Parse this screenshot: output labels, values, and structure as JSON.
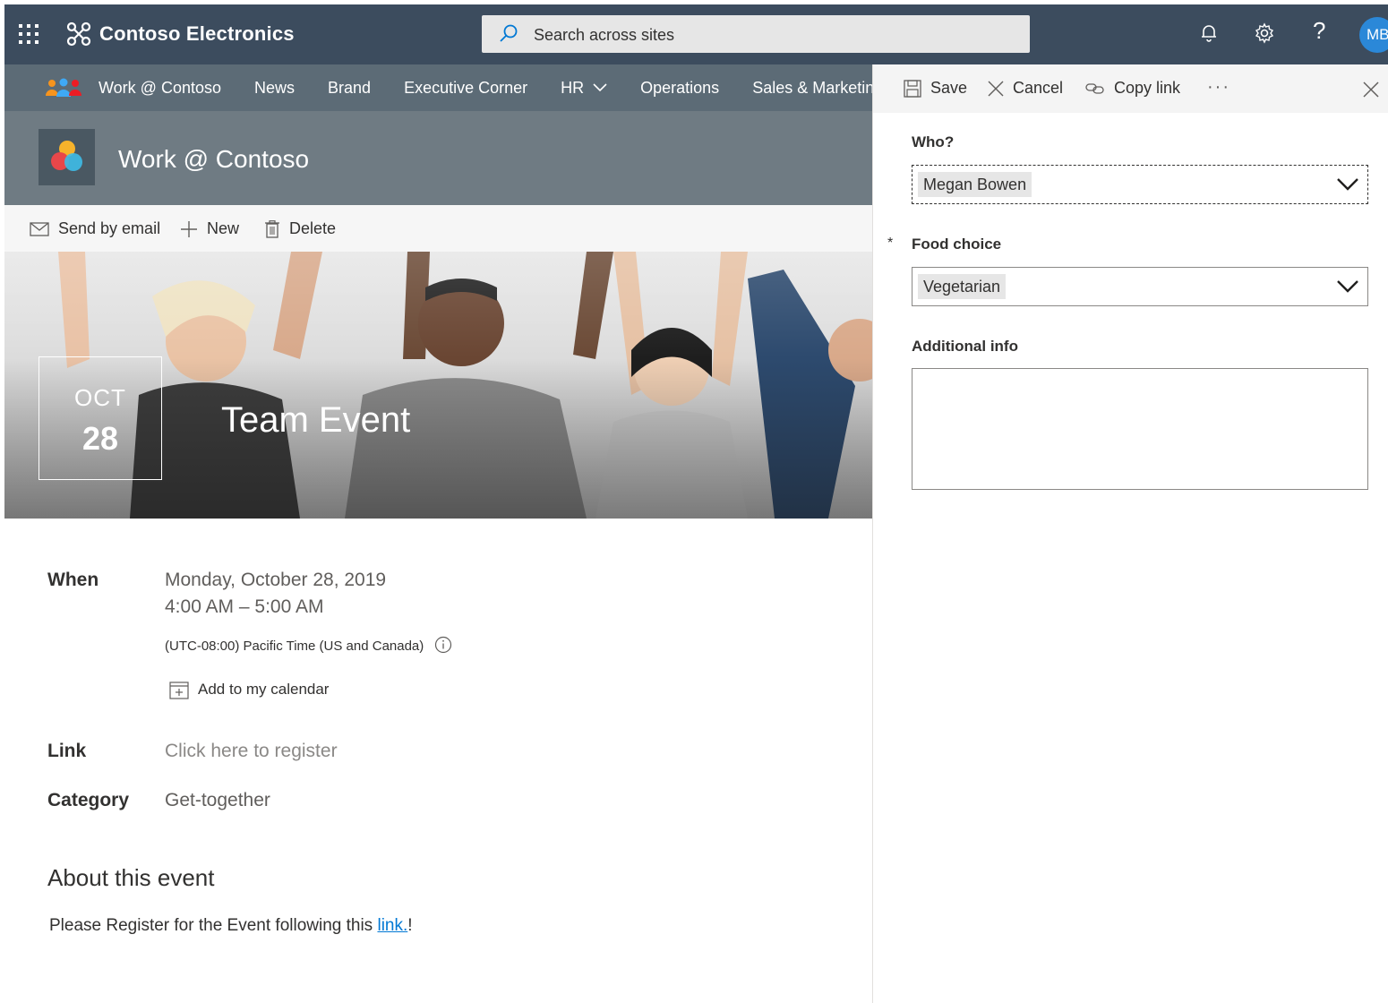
{
  "suitebar": {
    "brand": "Contoso Electronics",
    "search_placeholder": "Search across sites",
    "help": "?",
    "avatar_initials": "MB"
  },
  "sitenav": {
    "items": [
      "Work @ Contoso",
      "News",
      "Brand",
      "Executive Corner",
      "HR",
      "Operations",
      "Sales & Marketing"
    ]
  },
  "site": {
    "title": "Work @ Contoso"
  },
  "commands": {
    "send_by_email": "Send by email",
    "new": "New",
    "delete": "Delete"
  },
  "event": {
    "month": "OCT",
    "day": "28",
    "title": "Team Event",
    "when_label": "When",
    "date": "Monday, October 28, 2019",
    "time": "4:00 AM – 5:00 AM",
    "timezone": "(UTC-08:00) Pacific Time (US and Canada)",
    "add_to_calendar": "Add to my calendar",
    "link_label": "Link",
    "link_value": "Click here to register",
    "category_label": "Category",
    "category_value": "Get-together",
    "about_title": "About this event",
    "about_text_before": "Please Register for the Event following this ",
    "about_link": "link.",
    "about_text_after": "!"
  },
  "panel": {
    "save": "Save",
    "cancel": "Cancel",
    "copy_link": "Copy link",
    "more": "···",
    "fields": {
      "who_label": "Who?",
      "who_value": "Megan Bowen",
      "food_required_marker": "*",
      "food_label": "Food choice",
      "food_value": "Vegetarian",
      "info_label": "Additional info",
      "info_value": ""
    }
  },
  "colors": {
    "suitebar": "#3c4c5e",
    "sitenav": "#5c6b76",
    "siteheader": "#6f7b83",
    "accent": "#0078d4",
    "avatar": "#2b88d8"
  }
}
